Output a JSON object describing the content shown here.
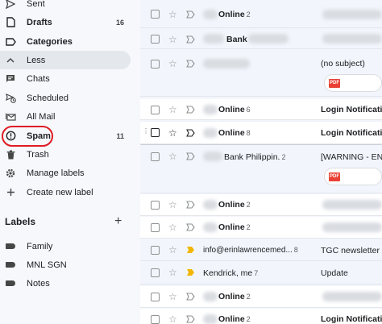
{
  "colors": {
    "spam_highlight": "#e01b24",
    "important_marker": "#f2b600",
    "pdf_badge": "#e94235"
  },
  "sidebar": {
    "items": [
      {
        "label": "Sent",
        "icon": "sent-icon",
        "count": ""
      },
      {
        "label": "Drafts",
        "icon": "draft-icon",
        "count": "16"
      },
      {
        "label": "Categories",
        "icon": "label-outline-icon",
        "count": ""
      },
      {
        "label": "Less",
        "icon": "chevron-up-icon",
        "count": ""
      },
      {
        "label": "Chats",
        "icon": "chat-icon",
        "count": ""
      },
      {
        "label": "Scheduled",
        "icon": "schedule-send-icon",
        "count": ""
      },
      {
        "label": "All Mail",
        "icon": "all-mail-icon",
        "count": ""
      },
      {
        "label": "Spam",
        "icon": "report-icon",
        "count": "11"
      },
      {
        "label": "Trash",
        "icon": "trash-icon",
        "count": ""
      },
      {
        "label": "Manage labels",
        "icon": "gear-icon",
        "count": ""
      },
      {
        "label": "Create new label",
        "icon": "plus-icon",
        "count": ""
      }
    ],
    "labels_heading": "Labels",
    "labels_add": "+",
    "labels": [
      {
        "label": "Family",
        "icon": "label-icon"
      },
      {
        "label": "MNL SGN",
        "icon": "label-icon"
      },
      {
        "label": "Notes",
        "icon": "label-icon"
      }
    ]
  },
  "emails": [
    {
      "sender": "Online",
      "count": "2",
      "subject": ""
    },
    {
      "sender": "Bank",
      "count": "",
      "subject": ""
    },
    {
      "sender": "",
      "count": "",
      "subject": "(no subject)",
      "attachment": "PDF"
    },
    {
      "sender": "Online",
      "count": "6",
      "subject": "Login Notificati"
    },
    {
      "sender": "Online",
      "count": "8",
      "subject": "Login Notificati"
    },
    {
      "sender": "Bank Philippin.",
      "count": "2",
      "subject": "[WARNING - ENC",
      "attachment": "PDF"
    },
    {
      "sender": "Online",
      "count": "2",
      "subject": ""
    },
    {
      "sender": "Online",
      "count": "2",
      "subject": ""
    },
    {
      "sender": "info@erinlawrencemed...",
      "count": "8",
      "subject": "TGC newsletter i"
    },
    {
      "sender": "Kendrick, me",
      "count": "7",
      "subject": "Update"
    },
    {
      "sender": "Online",
      "count": "2",
      "subject": ""
    },
    {
      "sender": "Online",
      "count": "2",
      "subject": "Login Notificati"
    }
  ]
}
